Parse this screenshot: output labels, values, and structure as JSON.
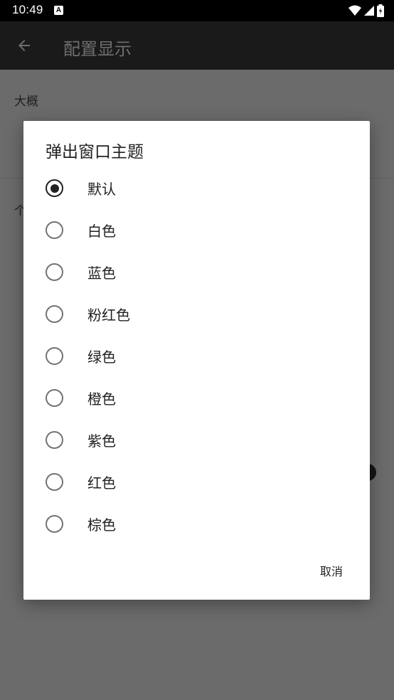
{
  "status_bar": {
    "time": "10:49",
    "notification_glyph": "A"
  },
  "app_bar": {
    "title": "配置显示",
    "back_icon": "arrow-back-icon"
  },
  "background": {
    "section_label": "大概",
    "partial_label": "个"
  },
  "dialog": {
    "title": "弹出窗口主题",
    "selected_index": 0,
    "options": [
      "默认",
      "白色",
      "蓝色",
      "粉红色",
      "绿色",
      "橙色",
      "紫色",
      "红色",
      "棕色"
    ],
    "cancel_label": "取消"
  }
}
